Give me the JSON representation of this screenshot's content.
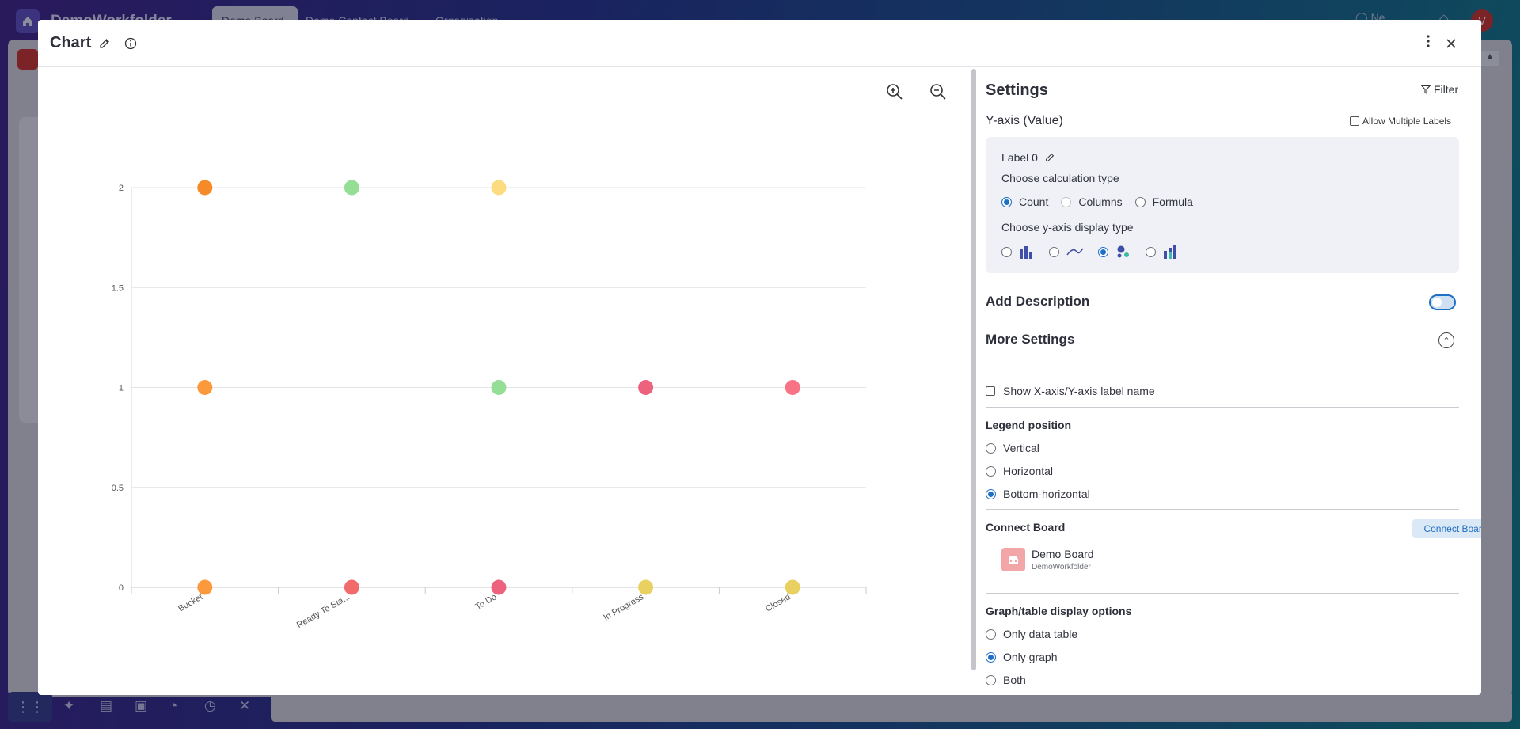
{
  "app": {
    "title": "DemoWorkfolder",
    "tabs": [
      "Demo Board",
      "Demo Contact Board",
      "Organization"
    ],
    "search_label": "Ne",
    "avatar_initial": "V"
  },
  "modal": {
    "title": "Chart"
  },
  "chart_data": {
    "type": "scatter",
    "categories": [
      "Bucket",
      "Ready To Sta...",
      "To Do",
      "In Progress",
      "Closed"
    ],
    "yticks": [
      0,
      0.5,
      1,
      1.5,
      2
    ],
    "ylim": [
      0,
      2
    ],
    "grid": true,
    "points": [
      {
        "category": "Bucket",
        "y": 2,
        "color": "#f7841c"
      },
      {
        "category": "Bucket",
        "y": 1,
        "color": "#fb9331"
      },
      {
        "category": "Bucket",
        "y": 0,
        "color": "#fb9331"
      },
      {
        "category": "Ready To Sta...",
        "y": 2,
        "color": "#8fdc8f"
      },
      {
        "category": "Ready To Sta...",
        "y": 0,
        "color": "#f26262"
      },
      {
        "category": "To Do",
        "y": 2,
        "color": "#fdd97a"
      },
      {
        "category": "To Do",
        "y": 1,
        "color": "#8fdc8f"
      },
      {
        "category": "To Do",
        "y": 0,
        "color": "#ec5b76"
      },
      {
        "category": "In Progress",
        "y": 1,
        "color": "#ec5b76"
      },
      {
        "category": "In Progress",
        "y": 0,
        "color": "#e8cf59"
      },
      {
        "category": "Closed",
        "y": 1,
        "color": "#f86b80"
      },
      {
        "category": "Closed",
        "y": 0,
        "color": "#e8cf59"
      }
    ]
  },
  "settings": {
    "title": "Settings",
    "filter_label": "Filter",
    "yaxis_title": "Y-axis (Value)",
    "allow_multiple_labels": "Allow Multiple Labels",
    "label_name": "Label 0",
    "calc_type_label": "Choose calculation type",
    "calc_options": [
      "Count",
      "Columns",
      "Formula"
    ],
    "calc_selected": "Count",
    "display_type_label": "Choose y-axis display type",
    "display_options": [
      "bar",
      "line",
      "scatter",
      "stacked-bar"
    ],
    "display_selected": "scatter",
    "add_description": "Add Description",
    "add_description_enabled": false,
    "more_settings": "More Settings",
    "show_axis_label": "Show X-axis/Y-axis label name",
    "legend_position_title": "Legend position",
    "legend_options": [
      "Vertical",
      "Horizontal",
      "Bottom-horizontal"
    ],
    "legend_selected": "Bottom-horizontal",
    "connect_board_title": "Connect Board",
    "connect_board_button": "Connect Board",
    "board_name": "Demo Board",
    "board_workspace": "DemoWorkfolder",
    "display_options_title": "Graph/table display options",
    "graph_table_options": [
      "Only data table",
      "Only graph",
      "Both"
    ],
    "graph_table_selected": "Only graph"
  },
  "colors": {
    "accent": "#1f6fc5",
    "label_box_bg": "#eff1f6"
  }
}
